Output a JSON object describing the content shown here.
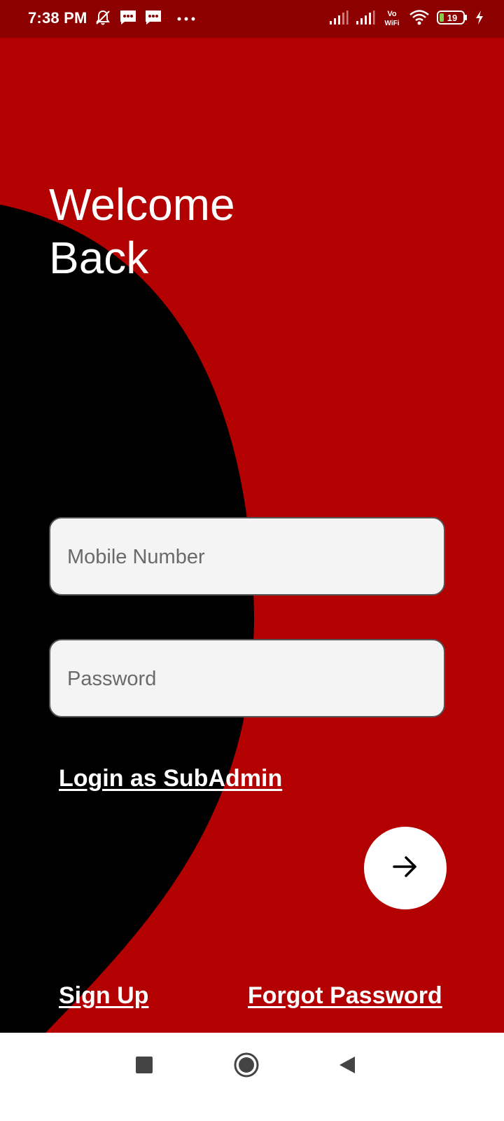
{
  "status_bar": {
    "time": "7:38 PM",
    "left_icons": [
      "notifications-muted-icon",
      "message-icon",
      "message-icon",
      "more-dots-icon"
    ],
    "right_icons": [
      "signal-icon",
      "signal-icon",
      "vowifi-icon",
      "wifi-icon",
      "battery-icon",
      "charging-bolt-icon"
    ],
    "vowifi_top": "Vo",
    "vowifi_bottom": "WiFi",
    "battery_level": "19"
  },
  "welcome": {
    "line1": "Welcome",
    "line2": "Back"
  },
  "form": {
    "mobile_placeholder": "Mobile Number",
    "password_placeholder": "Password"
  },
  "links": {
    "subadmin": "Login as SubAdmin",
    "signup": "Sign Up",
    "forgot": "Forgot Password"
  },
  "submit": {
    "icon": "arrow-right-icon"
  },
  "nav_bar": {
    "buttons": [
      "recents-square-icon",
      "home-circle-icon",
      "back-triangle-icon"
    ]
  },
  "colors": {
    "primary_red": "#b30000",
    "status_bar_red": "#8c0000",
    "blob_black": "#000000",
    "field_bg": "#f4f4f4",
    "text_white": "#ffffff"
  }
}
